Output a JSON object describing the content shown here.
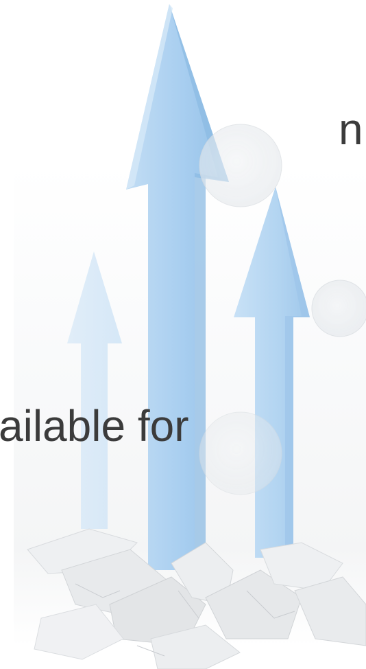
{
  "slide": {
    "text_line_1": "n",
    "text_line_2": "ailable for"
  },
  "colors": {
    "background": "#ffffff",
    "arrow_light": "#c7e0f5",
    "arrow_main": "#a9cff0",
    "arrow_edge": "#8dbbe2",
    "circle_fill": "#eceff2",
    "rubble": "#e4e6e8",
    "text": "#3b3b3b"
  },
  "decorations": {
    "arrows": [
      "small-left-arrow",
      "tall-center-arrow",
      "right-arrow"
    ],
    "circles": [
      "circle-upper",
      "circle-right",
      "circle-lower"
    ],
    "ground": "cracked-rubble"
  }
}
